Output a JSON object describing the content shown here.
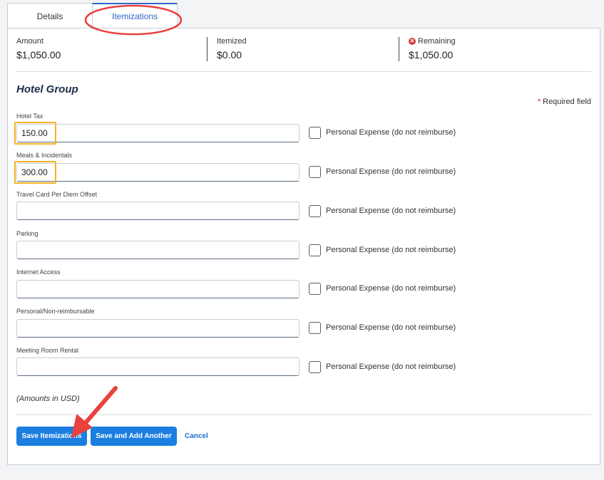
{
  "tabs": {
    "details": "Details",
    "itemizations": "Itemizations"
  },
  "summary": {
    "amount_label": "Amount",
    "amount_value": "$1,050.00",
    "itemized_label": "Itemized",
    "itemized_value": "$0.00",
    "remaining_label": "Remaining",
    "remaining_value": "$1,050.00"
  },
  "group_title": "Hotel Group",
  "required_text": "Required field",
  "checkbox_label": "Personal Expense (do not reimburse)",
  "fields": [
    {
      "label": "Hotel Tax",
      "value": "150.00",
      "checked": false
    },
    {
      "label": "Meals & Incidentals",
      "value": "300.00",
      "checked": false
    },
    {
      "label": "Travel Card Per Diem Offset",
      "value": "",
      "checked": false
    },
    {
      "label": "Parking",
      "value": "",
      "checked": false
    },
    {
      "label": "Internet Access",
      "value": "",
      "checked": false
    },
    {
      "label": "Personal/Non-reimbursable",
      "value": "",
      "checked": false
    },
    {
      "label": "Meeting Room Rental",
      "value": "",
      "checked": false
    }
  ],
  "amounts_note": "(Amounts in USD)",
  "buttons": {
    "save": "Save Itemizations",
    "save_add": "Save and Add Another",
    "cancel": "Cancel"
  },
  "colors": {
    "primary": "#1b7ee0",
    "tab_active": "#2f67c8",
    "highlight_box": "#f0b323",
    "annotation_red": "#e8413e",
    "error_red": "#d43b36"
  }
}
